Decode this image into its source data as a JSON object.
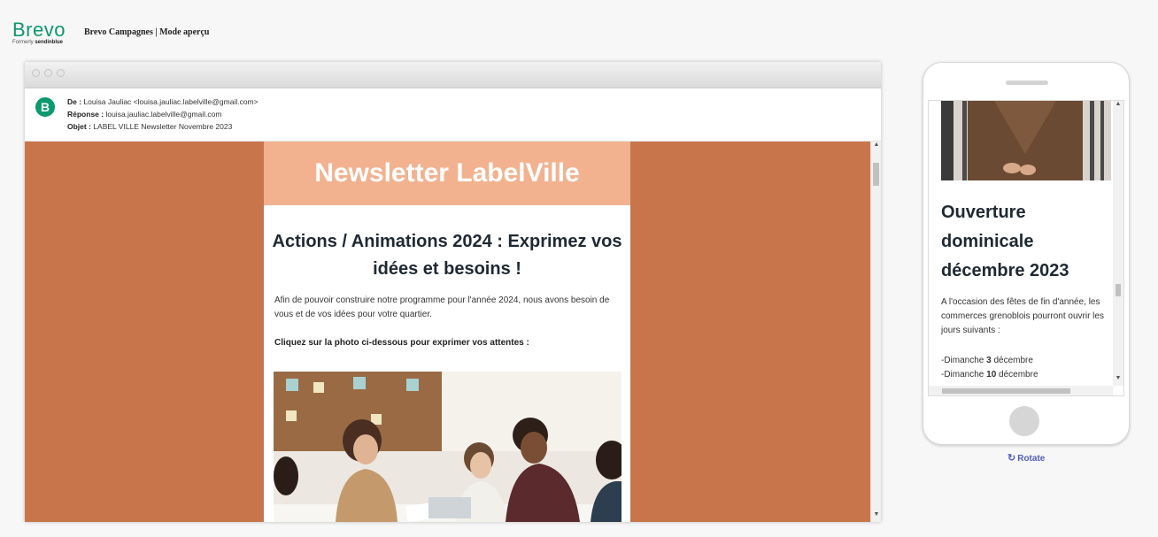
{
  "header": {
    "logo_word": "Brevo",
    "logo_sub_prefix": "Formerly",
    "logo_sub_brand": "sendinblue",
    "title": "Brevo Campagnes | Mode aperçu"
  },
  "email_meta": {
    "avatar_letter": "B",
    "from_label": "De :",
    "from_value": "Louisa Jauliac <louisa.jauliac.labelville@gmail.com>",
    "reply_label": "Réponse :",
    "reply_value": "louisa.jauliac.labelville@gmail.com",
    "subject_label": "Objet :",
    "subject_value": "LABEL VILLE Newsletter Novembre 2023"
  },
  "email_content": {
    "banner": "Newsletter LabelVille",
    "headline": "Actions / Animations 2024 : Exprimez vos idées et besoins !",
    "intro": "Afin de pouvoir construire notre programme pour l'année 2024, nous avons besoin de vous et de vos idées pour votre quartier.",
    "cta": "Cliquez sur la photo ci-dessous pour exprimer vos attentes :"
  },
  "mobile": {
    "title": "Ouverture dominicale décembre 2023",
    "body": "A l'occasion des fêtes de fin d'année, les commerces grenoblois pourront ouvrir les jours suivants :",
    "list": [
      {
        "prefix": "-Dimanche ",
        "day": "3",
        "suffix": " décembre"
      },
      {
        "prefix": "-Dimanche ",
        "day": "10",
        "suffix": " décembre"
      }
    ]
  },
  "rotate_label": "Rotate",
  "colors": {
    "brand": "#0b996e",
    "email_bg": "#c9754b",
    "banner_bg": "#f2b28f",
    "link": "#5160b8"
  }
}
